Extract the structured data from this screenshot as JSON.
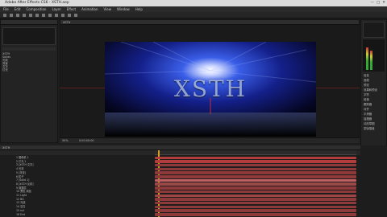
{
  "window": {
    "title": "Adobe After Effects CS6 - XSTH.aep"
  },
  "menu": [
    "File",
    "Edit",
    "Composition",
    "Layer",
    "Effect",
    "Animation",
    "View",
    "Window",
    "Help"
  ],
  "composition": {
    "title_text": "XSTH",
    "tab": "XSTH",
    "zoom": "50%",
    "timecode": "0:00:00:00"
  },
  "project": {
    "items": [
      "XSTH",
      "Solids",
      "光效",
      "背景",
      "文字",
      "灯光"
    ]
  },
  "timeline": {
    "tab": "XSTH",
    "layers": [
      {
        "num": "1",
        "name": "摄像机 1",
        "color": "#b33c3c"
      },
      {
        "num": "2",
        "name": "灯光 1",
        "color": "#b33c3c"
      },
      {
        "num": "3",
        "name": "[XSTH 文字]",
        "color": "#8f3a3a"
      },
      {
        "num": "4",
        "name": "光效",
        "color": "#8f3a3a"
      },
      {
        "num": "5",
        "name": "[背景]",
        "color": "#8f3a3a"
      },
      {
        "num": "6",
        "name": "粒子",
        "color": "#8f3a3a"
      },
      {
        "num": "7",
        "name": "[Solid 1]",
        "color": "#c06060"
      },
      {
        "num": "8",
        "name": "[XSTH 反射]",
        "color": "#9a4848"
      },
      {
        "num": "9",
        "name": "调整层",
        "color": "#8f3a3a"
      },
      {
        "num": "10",
        "name": "黑色 纯色",
        "color": "#8f3a3a"
      },
      {
        "num": "11",
        "name": "Light",
        "color": "#a04545"
      },
      {
        "num": "12",
        "name": "BG",
        "color": "#8f3a3a"
      },
      {
        "num": "13",
        "name": "光线",
        "color": "#8f3a3a"
      },
      {
        "num": "14",
        "name": "空白",
        "color": "#8f3a3a"
      },
      {
        "num": "15",
        "name": "nul",
        "color": "#8f3a3a"
      },
      {
        "num": "16",
        "name": "End",
        "color": "#8f3a3a"
      }
    ]
  },
  "right_panel": {
    "items": [
      "信息",
      "音频",
      "预览",
      "效果和预设",
      "字符",
      "段落",
      "跟踪器",
      "对齐",
      "平滑器",
      "摇摆器",
      "动态草图",
      "蒙版插值"
    ]
  }
}
